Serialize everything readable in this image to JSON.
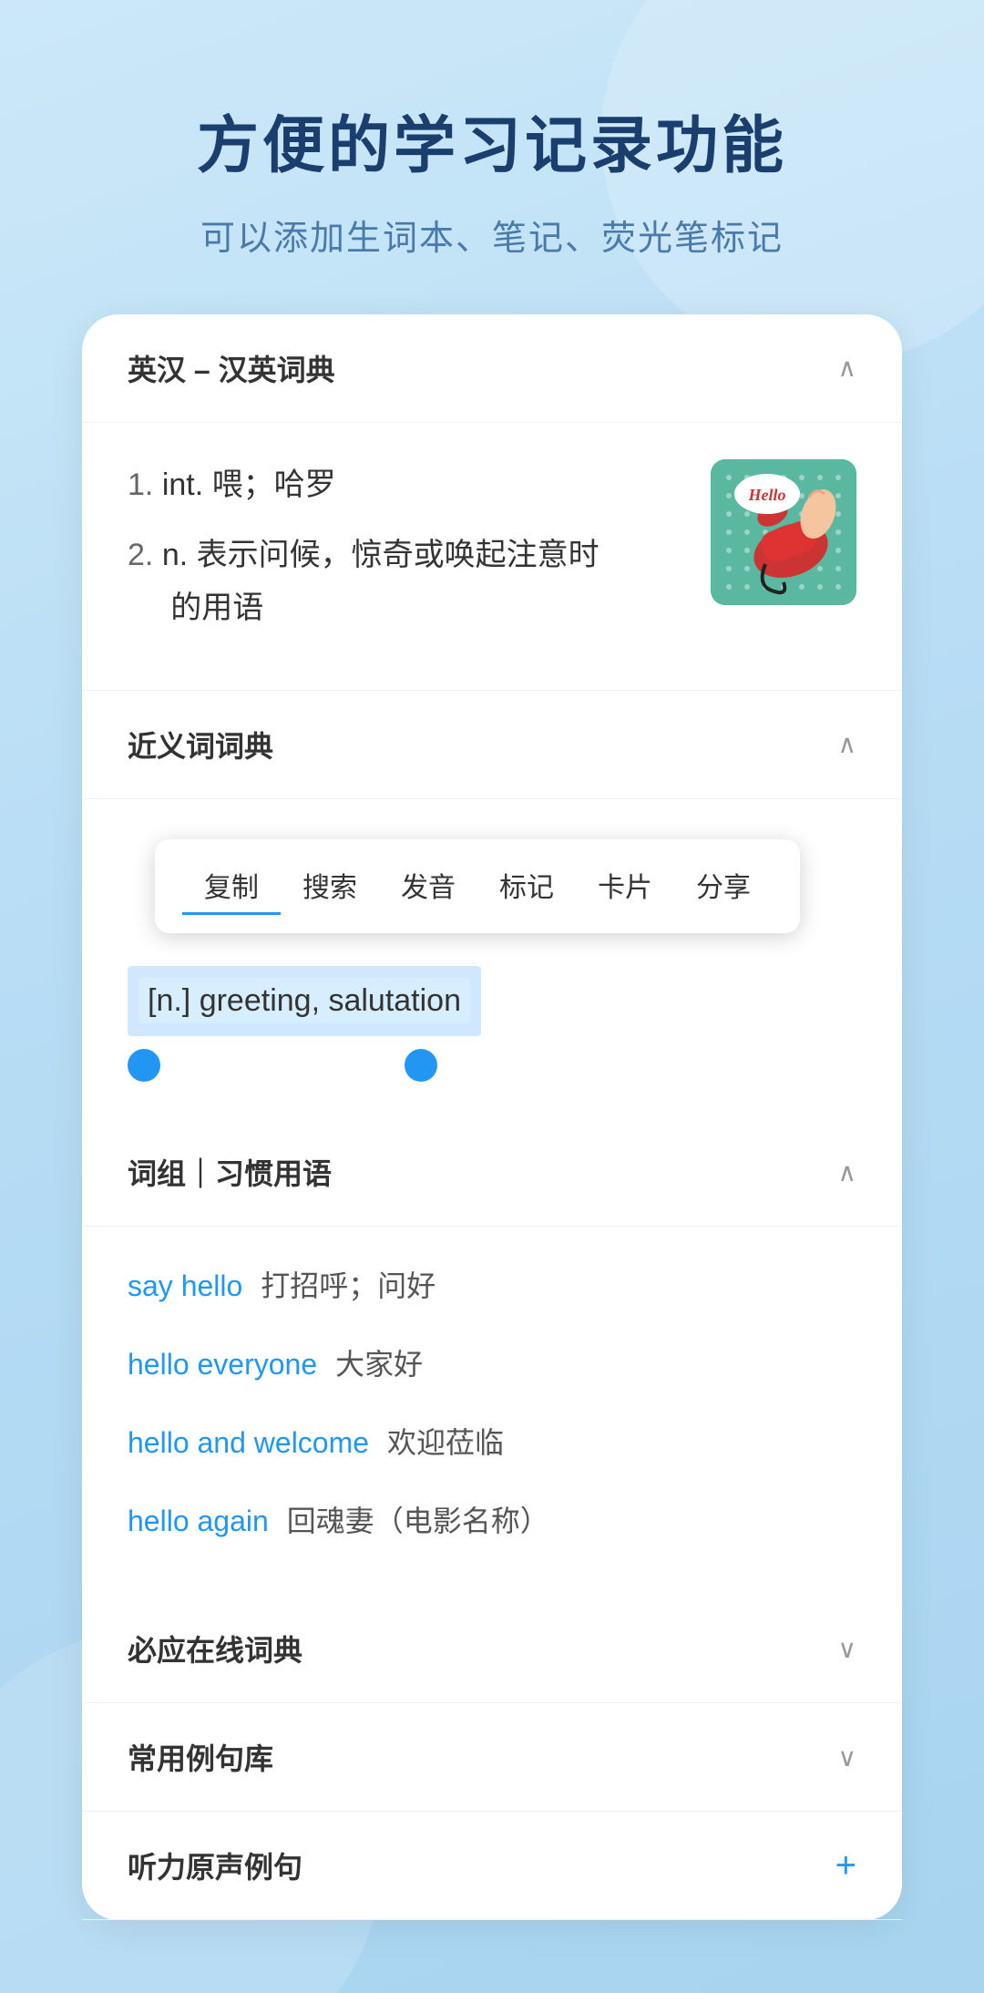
{
  "header": {
    "title": "方便的学习记录功能",
    "subtitle": "可以添加生词本、笔记、荧光笔标记"
  },
  "dict_section": {
    "label": "英汉 – 汉英词典",
    "chevron": "∧",
    "definitions": [
      {
        "number": "1.",
        "type": "int.",
        "text": "喂；哈罗"
      },
      {
        "number": "2.",
        "type": "n.",
        "text": "表示问候，惊奇或唤起注意时的用语"
      }
    ],
    "image_alt": "hello telephone illustration"
  },
  "synonyms_section": {
    "label": "近义词词典",
    "chevron": "∧",
    "context_menu": {
      "items": [
        "复制",
        "搜索",
        "发音",
        "标记",
        "卡片",
        "分享"
      ]
    },
    "synonym_text": "[n.] greeting, salutation"
  },
  "phrases_section": {
    "label": "词组｜习惯用语",
    "chevron": "∧",
    "phrases": [
      {
        "en": "say hello",
        "zh": "打招呼；问好"
      },
      {
        "en": "hello everyone",
        "zh": "大家好"
      },
      {
        "en": "hello and welcome",
        "zh": "欢迎莅临"
      },
      {
        "en": "hello again",
        "zh": "回魂妻（电影名称）"
      }
    ]
  },
  "collapsed_sections": [
    {
      "label": "必应在线词典",
      "icon": "chevron-down"
    },
    {
      "label": "常用例句库",
      "icon": "chevron-down"
    },
    {
      "label": "听力原声例句",
      "icon": "plus"
    }
  ]
}
